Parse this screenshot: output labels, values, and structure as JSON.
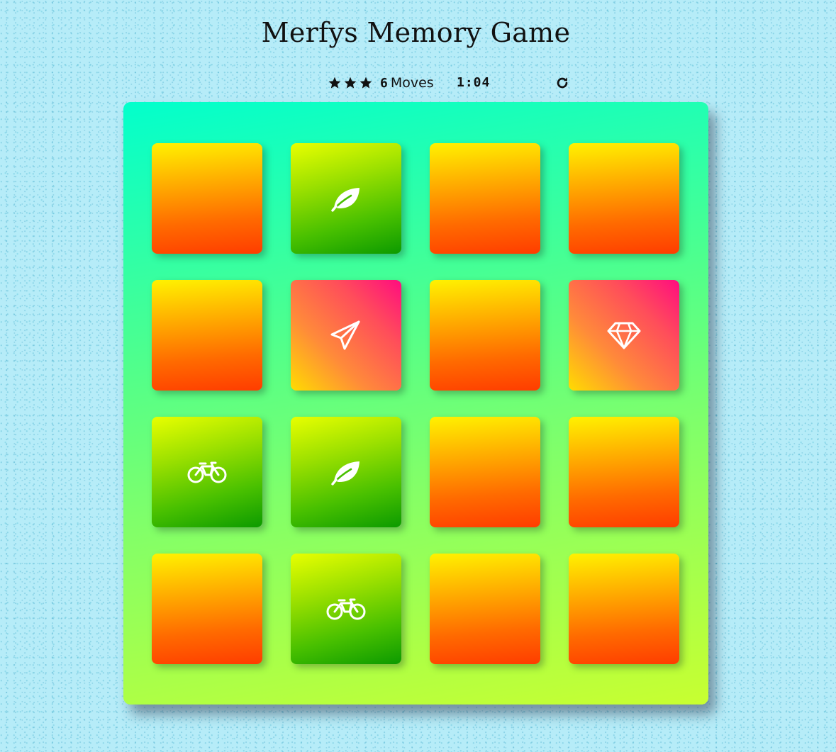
{
  "title": "Merfys Memory Game",
  "score": {
    "stars": 3,
    "moves_count": "6",
    "moves_label": "Moves",
    "timer": "1:04"
  },
  "colors": {
    "card_closed": "#ff7a00",
    "card_match": "#48c000",
    "card_open": "#ff4e5a",
    "deck": "#55ff88",
    "background": "#b6ecf8"
  },
  "cards": [
    {
      "state": "closed",
      "icon": ""
    },
    {
      "state": "match",
      "icon": "leaf-icon"
    },
    {
      "state": "closed",
      "icon": ""
    },
    {
      "state": "closed",
      "icon": ""
    },
    {
      "state": "closed",
      "icon": ""
    },
    {
      "state": "open",
      "icon": "paper-plane-icon"
    },
    {
      "state": "closed",
      "icon": ""
    },
    {
      "state": "open",
      "icon": "diamond-icon"
    },
    {
      "state": "match",
      "icon": "bicycle-icon"
    },
    {
      "state": "match",
      "icon": "leaf-icon"
    },
    {
      "state": "closed",
      "icon": ""
    },
    {
      "state": "closed",
      "icon": ""
    },
    {
      "state": "closed",
      "icon": ""
    },
    {
      "state": "match",
      "icon": "bicycle-icon"
    },
    {
      "state": "closed",
      "icon": ""
    },
    {
      "state": "closed",
      "icon": ""
    }
  ]
}
